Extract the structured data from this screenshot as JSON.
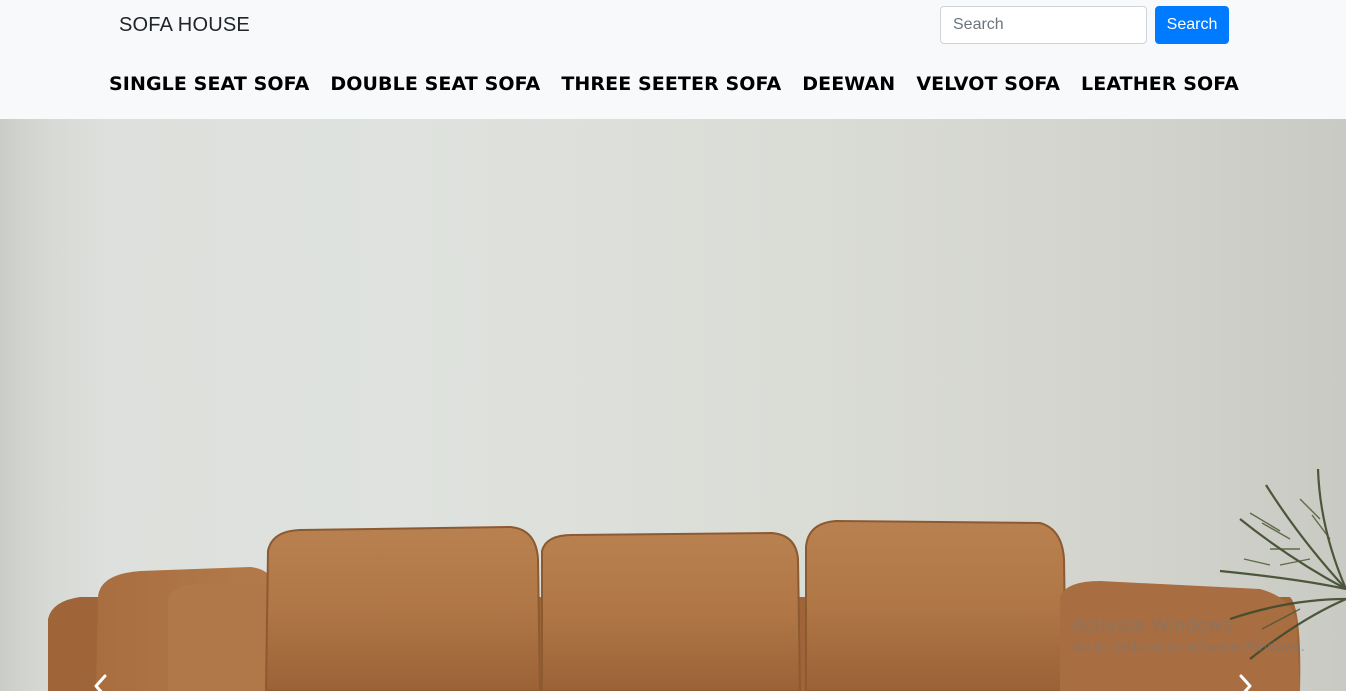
{
  "navbar": {
    "brand": "SOFA HOUSE",
    "search": {
      "placeholder": "Search",
      "value": "",
      "button_label": "Search"
    },
    "categories": [
      "SINGLE SEAT SOFA",
      "DOUBLE SEAT SOFA",
      "THREE SEETER SOFA",
      "DEEWAN",
      "VELVOT SOFA",
      "LEATHER SOFA"
    ]
  },
  "carousel": {
    "slide_image": "leather-sofa-photo",
    "prev_icon": "chevron-left-icon",
    "next_icon": "chevron-right-icon"
  },
  "watermark": {
    "title": "Activate Windows",
    "subtitle": "Go to Settings to activate Windows."
  },
  "colors": {
    "navbar_bg": "#f8f9fa",
    "primary": "#007bff",
    "sofa_leather": "#b07848"
  }
}
